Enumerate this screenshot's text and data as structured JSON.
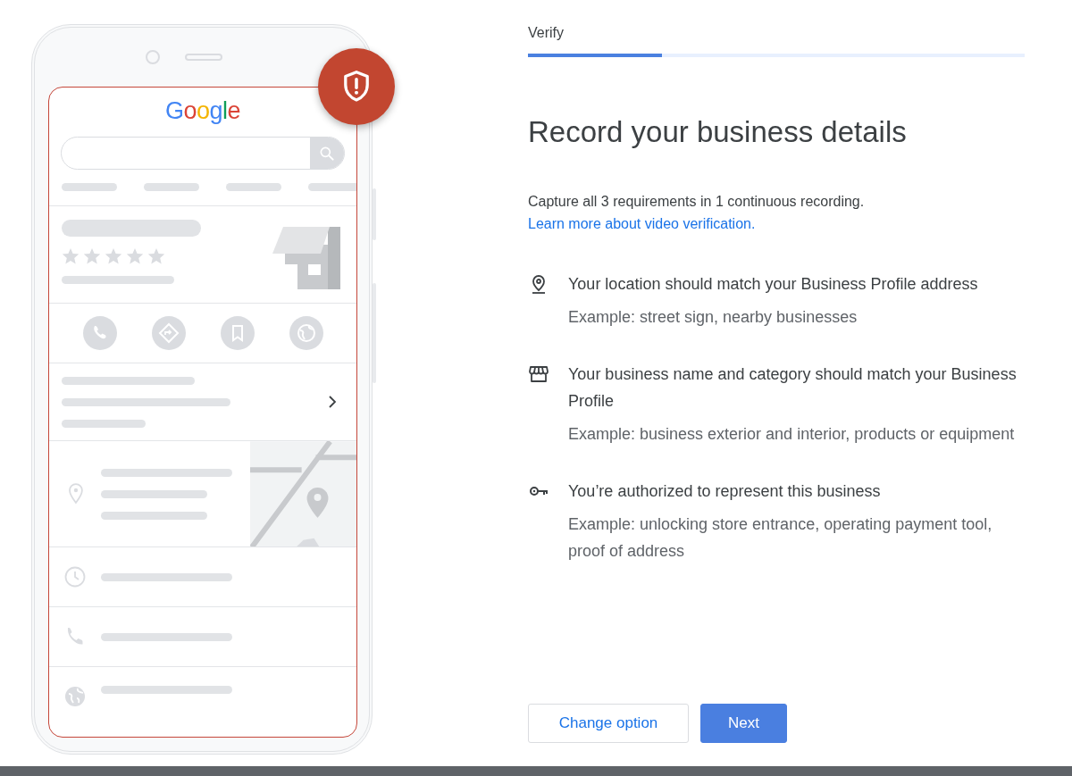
{
  "illustration": {
    "logo": "Google"
  },
  "header": {
    "step": "Verify",
    "progress": {
      "level": 0.27
    }
  },
  "title": "Record your business details",
  "intro": {
    "text": "Capture all 3 requirements in 1 continuous recording.",
    "link": "Learn more about video verification."
  },
  "requirements": [
    {
      "kind": "location",
      "title": "Your location should match your Business Profile address",
      "example": "Example: street sign, nearby businesses"
    },
    {
      "kind": "storefront",
      "title": "Your business name and category should match your Business Profile",
      "example": "Example: business exterior and interior, products or equipment"
    },
    {
      "kind": "key",
      "title": "You’re authorized to represent this business",
      "example": "Example: unlocking store entrance, operating payment tool, proof of address"
    }
  ],
  "buttons": [
    {
      "label": "Change option",
      "kind": "secondary"
    },
    {
      "label": "Next",
      "kind": "primary"
    }
  ]
}
